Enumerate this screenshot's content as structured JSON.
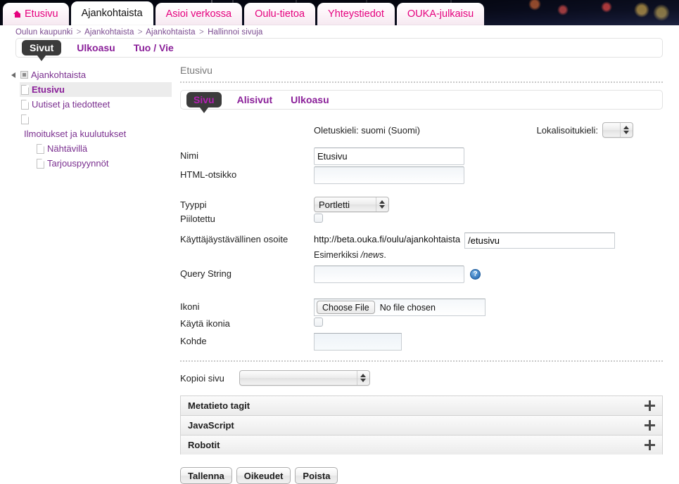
{
  "banner": {
    "alt": "city-night-photo-banner"
  },
  "topnav": {
    "tabs": [
      {
        "label": "Etusivu",
        "icon": "home-icon",
        "active": false
      },
      {
        "label": "Ajankohtaista",
        "icon": "",
        "active": true
      },
      {
        "label": "Asioi verkossa",
        "icon": "",
        "active": false
      },
      {
        "label": "Oulu-tietoa",
        "icon": "",
        "active": false
      },
      {
        "label": "Yhteystiedot",
        "icon": "",
        "active": false
      },
      {
        "label": "OUKA-julkaisu",
        "icon": "",
        "active": false
      }
    ]
  },
  "breadcrumb": {
    "items": [
      "Oulun kaupunki",
      "Ajankohtaista",
      "Ajankohtaista",
      "Hallinnoi sivuja"
    ],
    "separator": ">"
  },
  "adminbar": {
    "tabs": [
      {
        "label": "Sivut",
        "selected": true
      },
      {
        "label": "Ulkoasu",
        "selected": false
      },
      {
        "label": "Tuo / Vie",
        "selected": false
      }
    ]
  },
  "sidebar": {
    "items": [
      {
        "label": "Ajankohtaista",
        "indent": 0,
        "icon": "folder-box-icon",
        "toggle": true,
        "selected": false
      },
      {
        "label": "Etusivu",
        "indent": 1,
        "icon": "page-icon",
        "toggle": false,
        "selected": true
      },
      {
        "label": "Uutiset ja tiedotteet",
        "indent": 1,
        "icon": "page-icon",
        "toggle": false,
        "selected": false
      },
      {
        "label": "",
        "indent": 1,
        "icon": "page-icon",
        "toggle": false,
        "selected": false
      },
      {
        "label": "Ilmoitukset ja kuulutukset",
        "indent": 0,
        "icon": "",
        "toggle": false,
        "selected": false
      },
      {
        "label": "Nähtävillä",
        "indent": 1,
        "icon": "page-icon",
        "toggle": false,
        "selected": false
      },
      {
        "label": "Tarjouspyynnöt",
        "indent": 1,
        "icon": "page-icon",
        "toggle": false,
        "selected": false
      }
    ]
  },
  "main": {
    "page_title": "Etusivu",
    "subtabs": [
      {
        "label": "Sivu",
        "selected": true
      },
      {
        "label": "Alisivut",
        "selected": false
      },
      {
        "label": "Ulkoasu",
        "selected": false
      }
    ],
    "default_language": "Oletuskieli: suomi (Suomi)",
    "localization_label": "Lokalisoitukieli:",
    "localization_value": "",
    "fields": {
      "nimi_label": "Nimi",
      "nimi_value": "Etusivu",
      "html_otsikko_label": "HTML-otsikko",
      "html_otsikko_value": "",
      "tyyppi_label": "Tyyppi",
      "tyyppi_value": "Portletti",
      "piilotettu_label": "Piilotettu",
      "osoite_label": "Käyttäjäystävällinen osoite",
      "osoite_prefix": "http://beta.ouka.fi/oulu/ajankohtaista",
      "osoite_value": "/etusivu",
      "osoite_hint_pre": "Esimerkiksi ",
      "osoite_hint_em": "/news",
      "osoite_hint_post": ".",
      "query_string_label": "Query String",
      "query_string_value": "",
      "help_icon_label": "?",
      "ikoni_label": "Ikoni",
      "file_button_label": "Choose File",
      "file_status_text": "No file chosen",
      "kayta_ikonia_label": "Käytä ikonia",
      "kohde_label": "Kohde",
      "kohde_value": "",
      "kopioi_sivu_label": "Kopioi sivu",
      "kopioi_sivu_value": ""
    },
    "accordions": [
      {
        "title": "Metatieto tagit",
        "expand_icon": "plus-icon"
      },
      {
        "title": "JavaScript",
        "expand_icon": "plus-icon"
      },
      {
        "title": "Robotit",
        "expand_icon": "plus-icon"
      }
    ],
    "buttons": [
      {
        "label": "Tallenna"
      },
      {
        "label": "Oikeudet"
      },
      {
        "label": "Poista"
      }
    ]
  },
  "colors": {
    "accent_pink": "#e5007e",
    "accent_purple": "#8a1f99",
    "tab_dark": "#3b3b3b",
    "selected_row": "#ececec"
  }
}
